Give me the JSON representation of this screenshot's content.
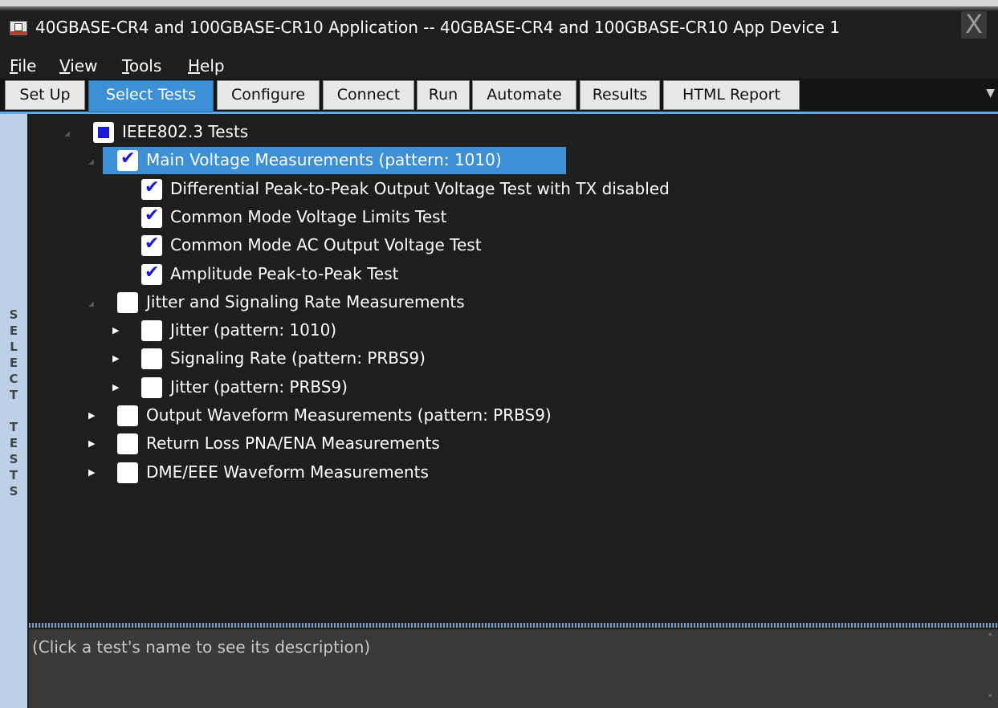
{
  "window": {
    "title": "40GBASE-CR4 and 100GBASE-CR10 Application -- 40GBASE-CR4 and 100GBASE-CR10 App Device 1",
    "icon": "app-icon",
    "close_glyph": "X"
  },
  "menu": [
    {
      "key": "F",
      "rest": "ile"
    },
    {
      "key": "V",
      "rest": "iew"
    },
    {
      "key": "T",
      "rest": "ools"
    },
    {
      "key": "H",
      "rest": "elp"
    }
  ],
  "tabs": [
    {
      "label": "Set Up"
    },
    {
      "label": "Select Tests",
      "active": true
    },
    {
      "label": "Configure"
    },
    {
      "label": "Connect"
    },
    {
      "label": "Run"
    },
    {
      "label": "Automate"
    },
    {
      "label": "Results"
    },
    {
      "label": "HTML Report"
    }
  ],
  "sidebar": {
    "label": "SELECT TESTS"
  },
  "tree": {
    "items": [
      {
        "label": "IEEE802.3 Tests",
        "state": "partial",
        "expander": "open"
      },
      {
        "label": "Main Voltage Measurements (pattern: 1010)",
        "state": "checked",
        "expander": "open",
        "selected": true
      },
      {
        "label": "Differential Peak-to-Peak Output Voltage Test with TX disabled",
        "state": "checked",
        "expander": "none"
      },
      {
        "label": "Common Mode Voltage Limits Test",
        "state": "checked",
        "expander": "none"
      },
      {
        "label": "Common Mode AC Output Voltage Test",
        "state": "checked",
        "expander": "none"
      },
      {
        "label": "Amplitude Peak-to-Peak Test",
        "state": "checked",
        "expander": "none"
      },
      {
        "label": "Jitter and Signaling Rate Measurements",
        "state": "unchecked",
        "expander": "open"
      },
      {
        "label": "Jitter (pattern: 1010)",
        "state": "unchecked",
        "expander": "closed"
      },
      {
        "label": "Signaling Rate (pattern: PRBS9)",
        "state": "unchecked",
        "expander": "closed"
      },
      {
        "label": "Jitter (pattern: PRBS9)",
        "state": "unchecked",
        "expander": "closed"
      },
      {
        "label": "Output Waveform Measurements (pattern: PRBS9)",
        "state": "unchecked",
        "expander": "closed"
      },
      {
        "label": "Return Loss PNA/ENA Measurements",
        "state": "unchecked",
        "expander": "closed"
      },
      {
        "label": "DME/EEE Waveform Measurements",
        "state": "unchecked",
        "expander": "closed"
      }
    ]
  },
  "description": {
    "placeholder": "(Click a test's name to see its description)"
  },
  "colors": {
    "accent": "#3d8fd6",
    "check": "#1a1ad8",
    "background": "#1e1e1e",
    "sidebar": "#bcd1e8"
  }
}
